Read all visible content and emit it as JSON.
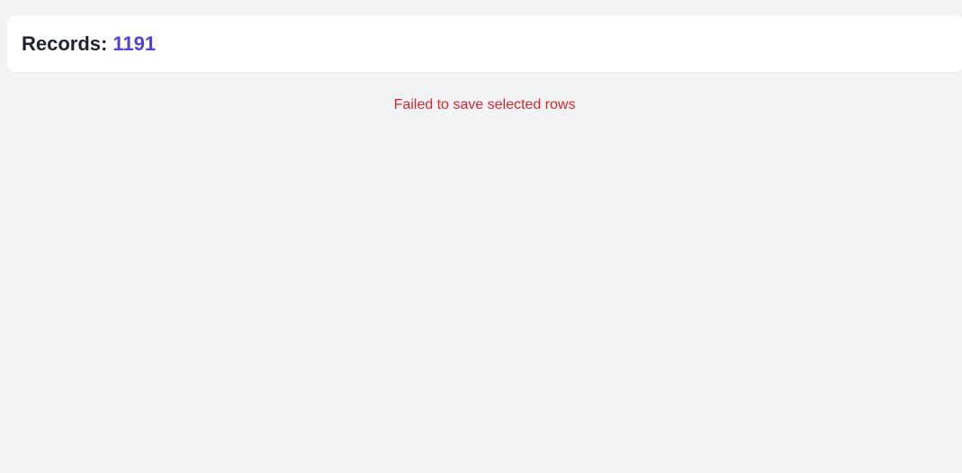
{
  "header": {
    "records_label": "Records:",
    "records_count": "1191"
  },
  "status": {
    "error_message": "Failed to save selected rows"
  },
  "colors": {
    "page_background": "#f2f3f5",
    "card_background": "#ffffff",
    "label_text": "#1f2233",
    "accent": "#5541d9",
    "error": "#d9282f"
  }
}
